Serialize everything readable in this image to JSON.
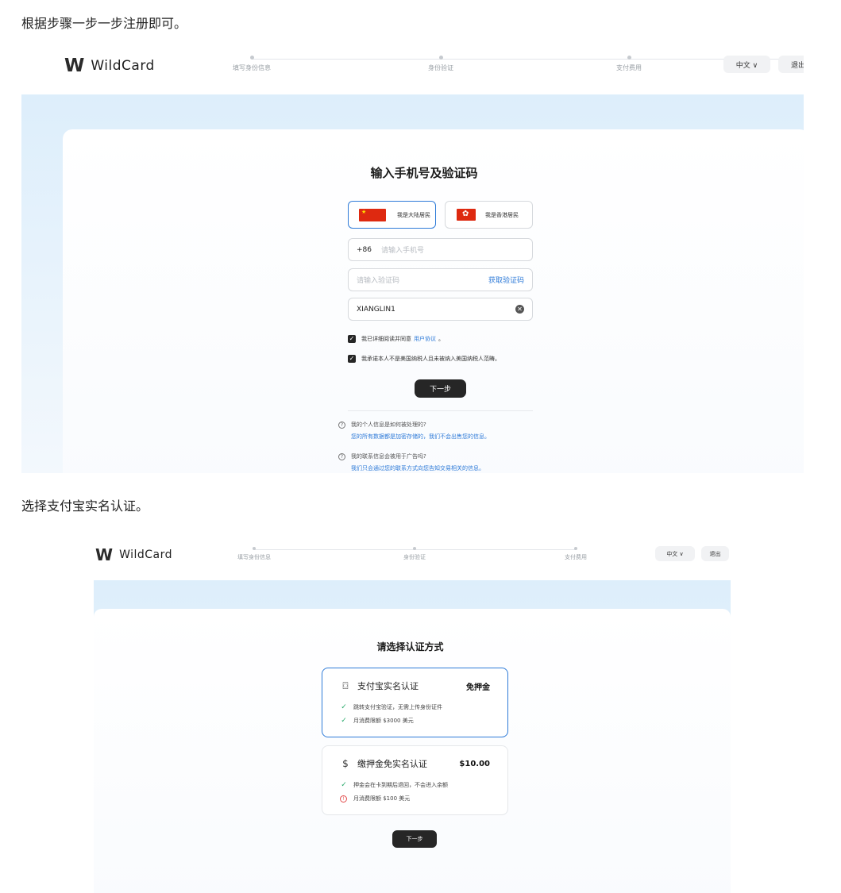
{
  "captions": {
    "first": "根据步骤一步一步注册即可。",
    "second": "选择支付宝实名认证。"
  },
  "app": {
    "logo_mark": "W",
    "logo_text": "WildCard",
    "steps": [
      "填写身份信息",
      "身份验证",
      "支付费用"
    ],
    "language": "中文 ∨",
    "logout": "退出"
  },
  "screen1": {
    "title": "输入手机号及验证码",
    "residency": {
      "mainland": "我是大陆居民",
      "hongkong": "我是香港居民",
      "selected": "mainland"
    },
    "phone": {
      "prefix": "+86",
      "placeholder": "请输入手机号"
    },
    "code": {
      "placeholder": "请输入验证码",
      "get_code": "获取验证码"
    },
    "invite": {
      "value": "XIANGLIN1"
    },
    "agreements": [
      {
        "text": "我已详细阅读并同意",
        "link": "用户协议",
        "suffix": "。",
        "checked": true
      },
      {
        "text": "我承诺本人不是美国纳税人且未被纳入美国纳税人范畴。",
        "link": "",
        "suffix": "",
        "checked": true
      }
    ],
    "next": "下一步",
    "faq": [
      {
        "q": "我的个人信息是如何被处理的?",
        "a": "您的所有数据都是加密存储的，我们不会出售您的信息。"
      },
      {
        "q": "我的联系信息会被用于广告吗?",
        "a": "我们只会通过您的联系方式向您告知交易相关的信息。"
      }
    ]
  },
  "screen2": {
    "title": "请选择认证方式",
    "options": [
      {
        "name": "支付宝实名认证",
        "price": "免押金",
        "selected": true,
        "icon": "face-scan-icon",
        "lines": [
          {
            "type": "check",
            "text": "跳转支付宝验证，无需上传身份证件"
          },
          {
            "type": "check",
            "text": "月消费限额 $3000 美元"
          }
        ]
      },
      {
        "name": "缴押金免实名认证",
        "price": "$10.00",
        "selected": false,
        "icon": "dollar-icon",
        "lines": [
          {
            "type": "check",
            "text": "押金会在卡到期后退回，不会进入余额"
          },
          {
            "type": "warn",
            "text": "月消费限额 $100 美元"
          }
        ]
      }
    ],
    "next": "下一步"
  },
  "colors": {
    "accent": "#2f7bd8",
    "primary_button": "#262626",
    "success": "#27a96a",
    "warning": "#e24b4b"
  }
}
